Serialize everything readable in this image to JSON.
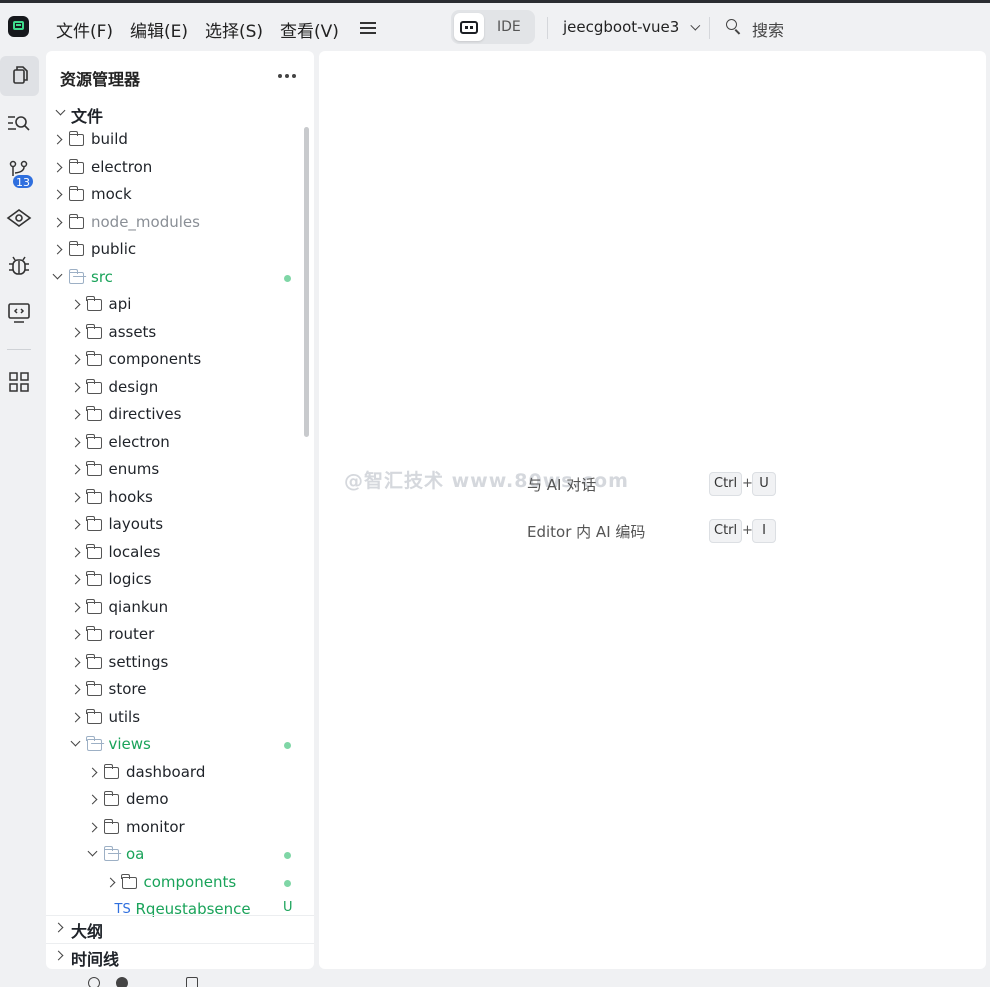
{
  "titlebar": {
    "menus": [
      "文件(F)",
      "编辑(E)",
      "选择(S)",
      "查看(V)"
    ],
    "mode_label": "IDE",
    "project_name": "jeecgboot-vue3",
    "search_label": "搜索"
  },
  "activity": {
    "scm_badge": "13",
    "items": [
      "explorer-icon",
      "search-icon",
      "source-control-icon",
      "preview-icon",
      "debug-icon",
      "remote-icon",
      "extensions-icon"
    ]
  },
  "sidebar": {
    "title": "资源管理器",
    "files_section": "文件",
    "outline_section": "大纲",
    "timeline_section": "时间线",
    "tree": [
      {
        "name": "build",
        "depth": 0,
        "state": "closed"
      },
      {
        "name": "electron",
        "depth": 0,
        "state": "closed"
      },
      {
        "name": "mock",
        "depth": 0,
        "state": "closed"
      },
      {
        "name": "node_modules",
        "depth": 0,
        "state": "closed",
        "muted": true
      },
      {
        "name": "public",
        "depth": 0,
        "state": "closed"
      },
      {
        "name": "src",
        "depth": 0,
        "state": "open",
        "modified": true
      },
      {
        "name": "api",
        "depth": 1,
        "state": "closed"
      },
      {
        "name": "assets",
        "depth": 1,
        "state": "closed"
      },
      {
        "name": "components",
        "depth": 1,
        "state": "closed"
      },
      {
        "name": "design",
        "depth": 1,
        "state": "closed"
      },
      {
        "name": "directives",
        "depth": 1,
        "state": "closed"
      },
      {
        "name": "electron",
        "depth": 1,
        "state": "closed"
      },
      {
        "name": "enums",
        "depth": 1,
        "state": "closed"
      },
      {
        "name": "hooks",
        "depth": 1,
        "state": "closed"
      },
      {
        "name": "layouts",
        "depth": 1,
        "state": "closed"
      },
      {
        "name": "locales",
        "depth": 1,
        "state": "closed"
      },
      {
        "name": "logics",
        "depth": 1,
        "state": "closed"
      },
      {
        "name": "qiankun",
        "depth": 1,
        "state": "closed"
      },
      {
        "name": "router",
        "depth": 1,
        "state": "closed"
      },
      {
        "name": "settings",
        "depth": 1,
        "state": "closed"
      },
      {
        "name": "store",
        "depth": 1,
        "state": "closed"
      },
      {
        "name": "utils",
        "depth": 1,
        "state": "closed"
      },
      {
        "name": "views",
        "depth": 1,
        "state": "open",
        "modified": true
      },
      {
        "name": "dashboard",
        "depth": 2,
        "state": "closed"
      },
      {
        "name": "demo",
        "depth": 2,
        "state": "closed"
      },
      {
        "name": "monitor",
        "depth": 2,
        "state": "closed"
      },
      {
        "name": "oa",
        "depth": 2,
        "state": "open",
        "modified": true
      },
      {
        "name": "components",
        "depth": 3,
        "state": "closed",
        "modified": true
      },
      {
        "name": "Rqeustabsence",
        "depth": 3,
        "state": "file",
        "file_icon": "TS",
        "git_status": "U"
      }
    ]
  },
  "main": {
    "hints": [
      {
        "label": "与 AI 对话",
        "keys": [
          "Ctrl",
          "U"
        ]
      },
      {
        "label": "Editor 内 AI 编码",
        "keys": [
          "Ctrl",
          "I"
        ]
      }
    ],
    "plus": "+",
    "watermark": "@智汇技术 www.80ws.com"
  },
  "colors": {
    "accent_green": "#1aa35a",
    "badge_blue": "#2f6fde",
    "background": "#f0f1f3"
  }
}
